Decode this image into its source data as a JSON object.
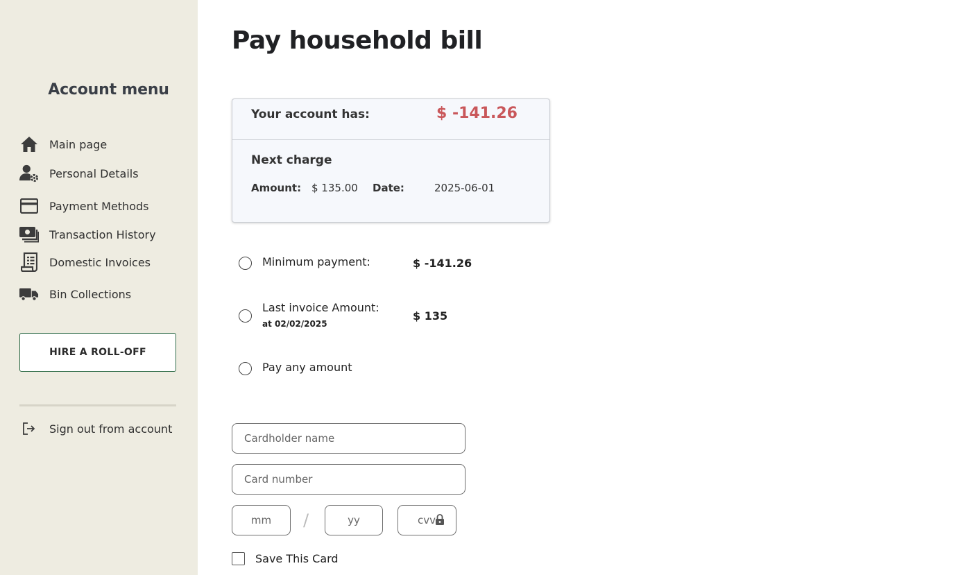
{
  "sidebar": {
    "title": "Account menu",
    "items": [
      {
        "label": "Main page",
        "icon": "home-icon"
      },
      {
        "label": "Personal Details",
        "icon": "user-gear-icon"
      },
      {
        "label": "Payment Methods",
        "icon": "credit-card-icon"
      },
      {
        "label": "Transaction History",
        "icon": "money-stack-icon"
      },
      {
        "label": "Domestic Invoices",
        "icon": "receipt-icon"
      },
      {
        "label": "Bin Collections",
        "icon": "truck-icon"
      }
    ],
    "hire_button": "HIRE A ROLL-OFF",
    "sign_out": {
      "label": "Sign out from account",
      "icon": "sign-out-icon"
    }
  },
  "main": {
    "title": "Pay household bill",
    "account": {
      "balance_label": "Your account has:",
      "balance_value": "$ -141.26",
      "next_charge_title": "Next charge",
      "amount_label": "Amount:",
      "amount_value": "$ 135.00",
      "date_label": "Date:",
      "date_value": "2025-06-01"
    },
    "options": {
      "minimum": {
        "label": "Minimum payment:",
        "amount": "$ -141.26"
      },
      "last_invoice": {
        "label": "Last invoice Amount:",
        "sub": "at 02/02/2025",
        "amount": "$ 135"
      },
      "any": {
        "label": "Pay any amount"
      }
    },
    "form": {
      "cardholder_placeholder": "Cardholder name",
      "card_number_placeholder": "Card number",
      "mm_placeholder": "mm",
      "separator": "/",
      "yy_placeholder": "yy",
      "cvv_placeholder": "cvv",
      "save_card_label": "Save This Card"
    }
  },
  "colors": {
    "sidebar_bg": "#eeece1",
    "negative": "#c9575a",
    "accent_border": "#2e6b47"
  }
}
